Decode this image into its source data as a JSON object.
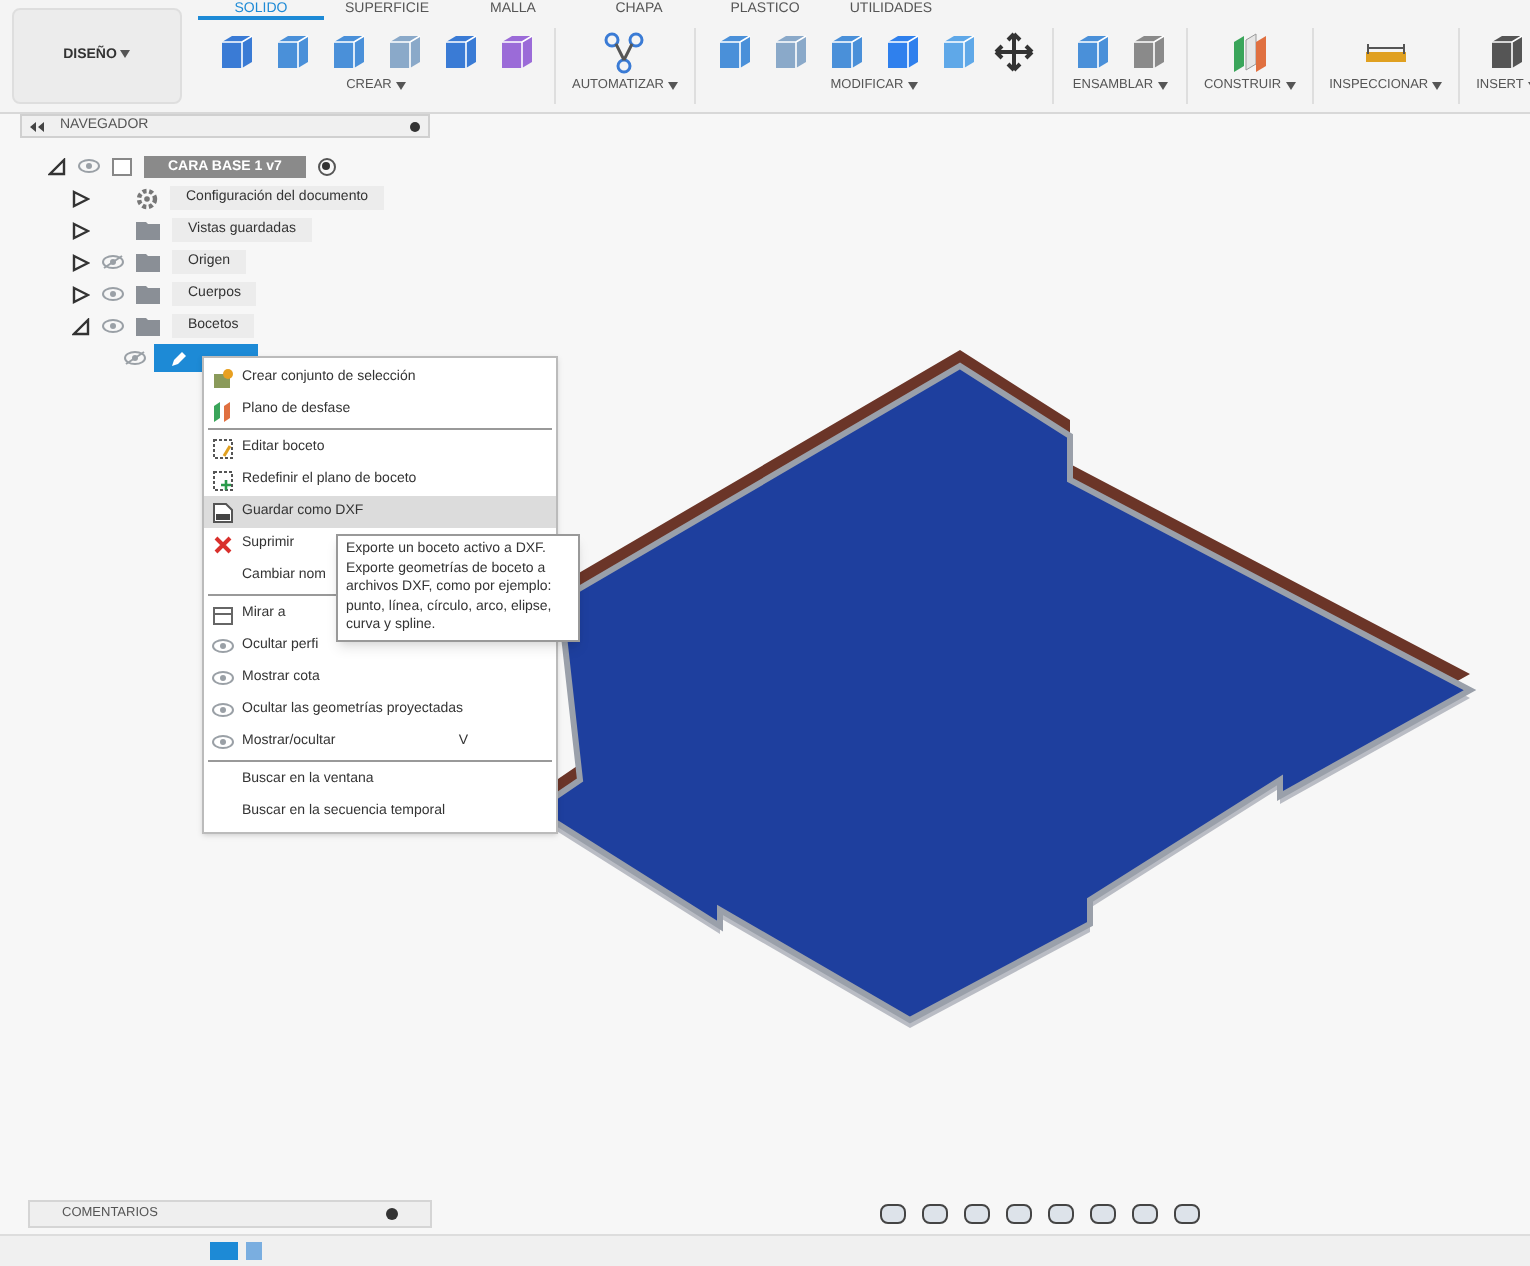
{
  "workspace_button": "DISEÑO",
  "tabs": [
    {
      "label": "SOLIDO",
      "selected": true
    },
    {
      "label": "SUPERFICIE",
      "selected": false
    },
    {
      "label": "MALLA",
      "selected": false
    },
    {
      "label": "CHAPA",
      "selected": false
    },
    {
      "label": "PLASTICO",
      "selected": false
    },
    {
      "label": "UTILIDADES",
      "selected": false
    }
  ],
  "groups": [
    {
      "label": "CREAR"
    },
    {
      "label": "AUTOMATIZAR"
    },
    {
      "label": "MODIFICAR"
    },
    {
      "label": "ENSAMBLAR"
    },
    {
      "label": "CONSTRUIR"
    },
    {
      "label": "INSPECCIONAR"
    },
    {
      "label": "INSERT"
    }
  ],
  "navigator": {
    "title": "NAVEGADOR",
    "root": {
      "label": "CARA BASE 1 v7",
      "expanded": true,
      "visible": true,
      "children": [
        {
          "label": "Configuración del documento",
          "kind": "settings",
          "expanded": false
        },
        {
          "label": "Vistas guardadas",
          "kind": "folder",
          "expanded": false
        },
        {
          "label": "Origen",
          "kind": "folder",
          "expanded": false,
          "visible": false
        },
        {
          "label": "Cuerpos",
          "kind": "folder",
          "expanded": false,
          "visible": true
        },
        {
          "label": "Bocetos",
          "kind": "folder",
          "expanded": true,
          "visible": true,
          "children": [
            {
              "kind": "sketch",
              "selected": true,
              "visible": false
            }
          ]
        }
      ]
    }
  },
  "context_menu": [
    {
      "kind": "item",
      "label": "Crear conjunto de selección",
      "highlighted": false
    },
    {
      "kind": "item",
      "label": "Plano de desfase",
      "highlighted": false
    },
    {
      "kind": "separator"
    },
    {
      "kind": "item",
      "label": "Editar boceto",
      "highlighted": false
    },
    {
      "kind": "item",
      "label": "Redefinir el plano de boceto",
      "highlighted": false
    },
    {
      "kind": "item",
      "label": "Guardar como DXF",
      "highlighted": true
    },
    {
      "kind": "item",
      "label": "Suprimir",
      "highlighted": false
    },
    {
      "kind": "item",
      "label": "Cambiar nom",
      "highlighted": false
    },
    {
      "kind": "separator"
    },
    {
      "kind": "item",
      "label": "Mirar a",
      "highlighted": false
    },
    {
      "kind": "item",
      "label": "Ocultar perfi",
      "highlighted": false
    },
    {
      "kind": "item",
      "label": "Mostrar cota",
      "highlighted": false
    },
    {
      "kind": "item",
      "label": "Ocultar las geometrías proyectadas",
      "highlighted": false
    },
    {
      "kind": "item",
      "label": "Mostrar/ocultar",
      "shortcut": "V",
      "highlighted": false
    },
    {
      "kind": "separator"
    },
    {
      "kind": "item",
      "label": "Buscar en la ventana",
      "highlighted": false
    },
    {
      "kind": "item",
      "label": "Buscar en la secuencia temporal",
      "highlighted": false
    }
  ],
  "tooltip": "Exporte un boceto activo a DXF. Exporte geometrías de boceto a archivos DXF, como por ejemplo: punto, línea, círculo, arco, elipse, curva y spline.",
  "comments": {
    "title": "COMENTARIOS"
  }
}
